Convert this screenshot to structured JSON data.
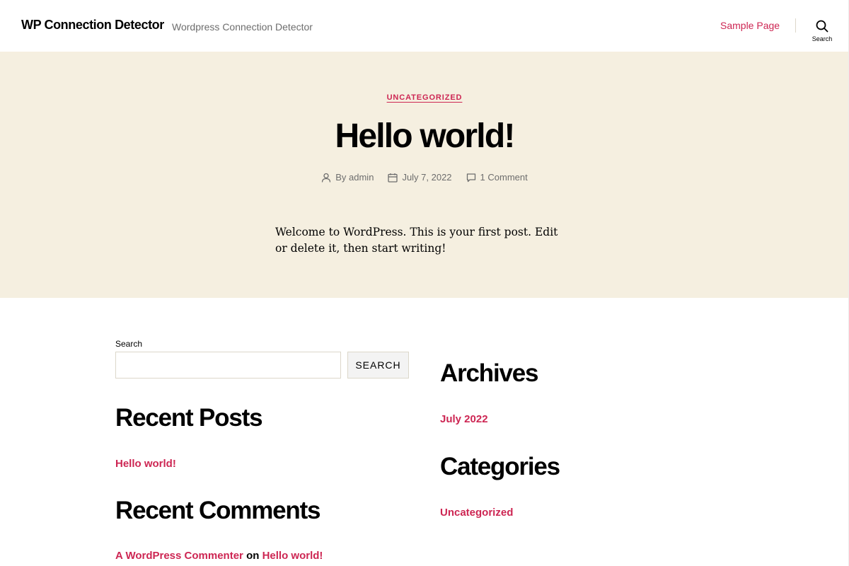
{
  "header": {
    "site_title": "WP Connection Detector",
    "site_description": "Wordpress Connection Detector",
    "nav": [
      "Sample Page"
    ],
    "search_label": "Search"
  },
  "post": {
    "category": "UNCATEGORIZED",
    "title": "Hello world!",
    "author": "By admin",
    "date": "July 7, 2022",
    "comments": "1 Comment",
    "excerpt": "Welcome to WordPress. This is your first post. Edit or delete it, then start writing!"
  },
  "widgets": {
    "search": {
      "label": "Search",
      "button": "SEARCH",
      "value": ""
    },
    "recent_posts": {
      "heading": "Recent Posts",
      "items": [
        "Hello world!"
      ]
    },
    "recent_comments": {
      "heading": "Recent Comments",
      "author": "A WordPress Commenter",
      "on": "on",
      "post": "Hello world!"
    },
    "archives": {
      "heading": "Archives",
      "items": [
        "July 2022"
      ]
    },
    "categories": {
      "heading": "Categories",
      "items": [
        "Uncategorized"
      ]
    }
  },
  "colors": {
    "accent": "#cd2653",
    "hero_bg": "#f5efe0",
    "meta_text": "#6d6d6d"
  },
  "icons": {
    "search": "search-icon",
    "author": "user-icon",
    "date": "calendar-icon",
    "comments": "comment-bubble-icon"
  }
}
